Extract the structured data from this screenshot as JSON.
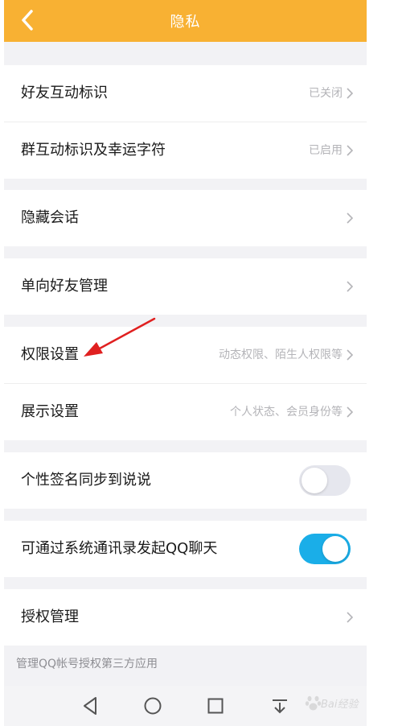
{
  "header": {
    "title": "隐私",
    "back_icon": "chevron-left-icon",
    "background": "#f8b133"
  },
  "groups": [
    {
      "rows": [
        {
          "label": "好友互动标识",
          "value": "已关闭"
        },
        {
          "label": "群互动标识及幸运字符",
          "value": "已启用"
        }
      ]
    },
    {
      "rows": [
        {
          "label": "隐藏会话",
          "value": ""
        }
      ]
    },
    {
      "rows": [
        {
          "label": "单向好友管理",
          "value": ""
        }
      ]
    },
    {
      "rows": [
        {
          "label": "权限设置",
          "value": "动态权限、陌生人权限等"
        },
        {
          "label": "展示设置",
          "value": "个人状态、会员身份等"
        }
      ]
    },
    {
      "rows": [
        {
          "label": "个性签名同步到说说",
          "toggle": false
        }
      ]
    },
    {
      "rows": [
        {
          "label": "可通过系统通讯录发起QQ聊天",
          "toggle": true
        }
      ]
    },
    {
      "rows": [
        {
          "label": "授权管理",
          "value": ""
        }
      ]
    }
  ],
  "footnote": "管理QQ帐号授权第三方应用",
  "navbar": {
    "buttons": [
      "back-triangle-icon",
      "home-circle-icon",
      "recents-square-icon",
      "notification-pull-icon"
    ]
  },
  "annotation": {
    "arrow_color": "#e02020"
  },
  "watermark": {
    "text": "Bai经验"
  },
  "colors": {
    "toggle_on": "#1aaee8",
    "toggle_off": "#e6e7ee",
    "page_background": "#f2f2f5"
  }
}
